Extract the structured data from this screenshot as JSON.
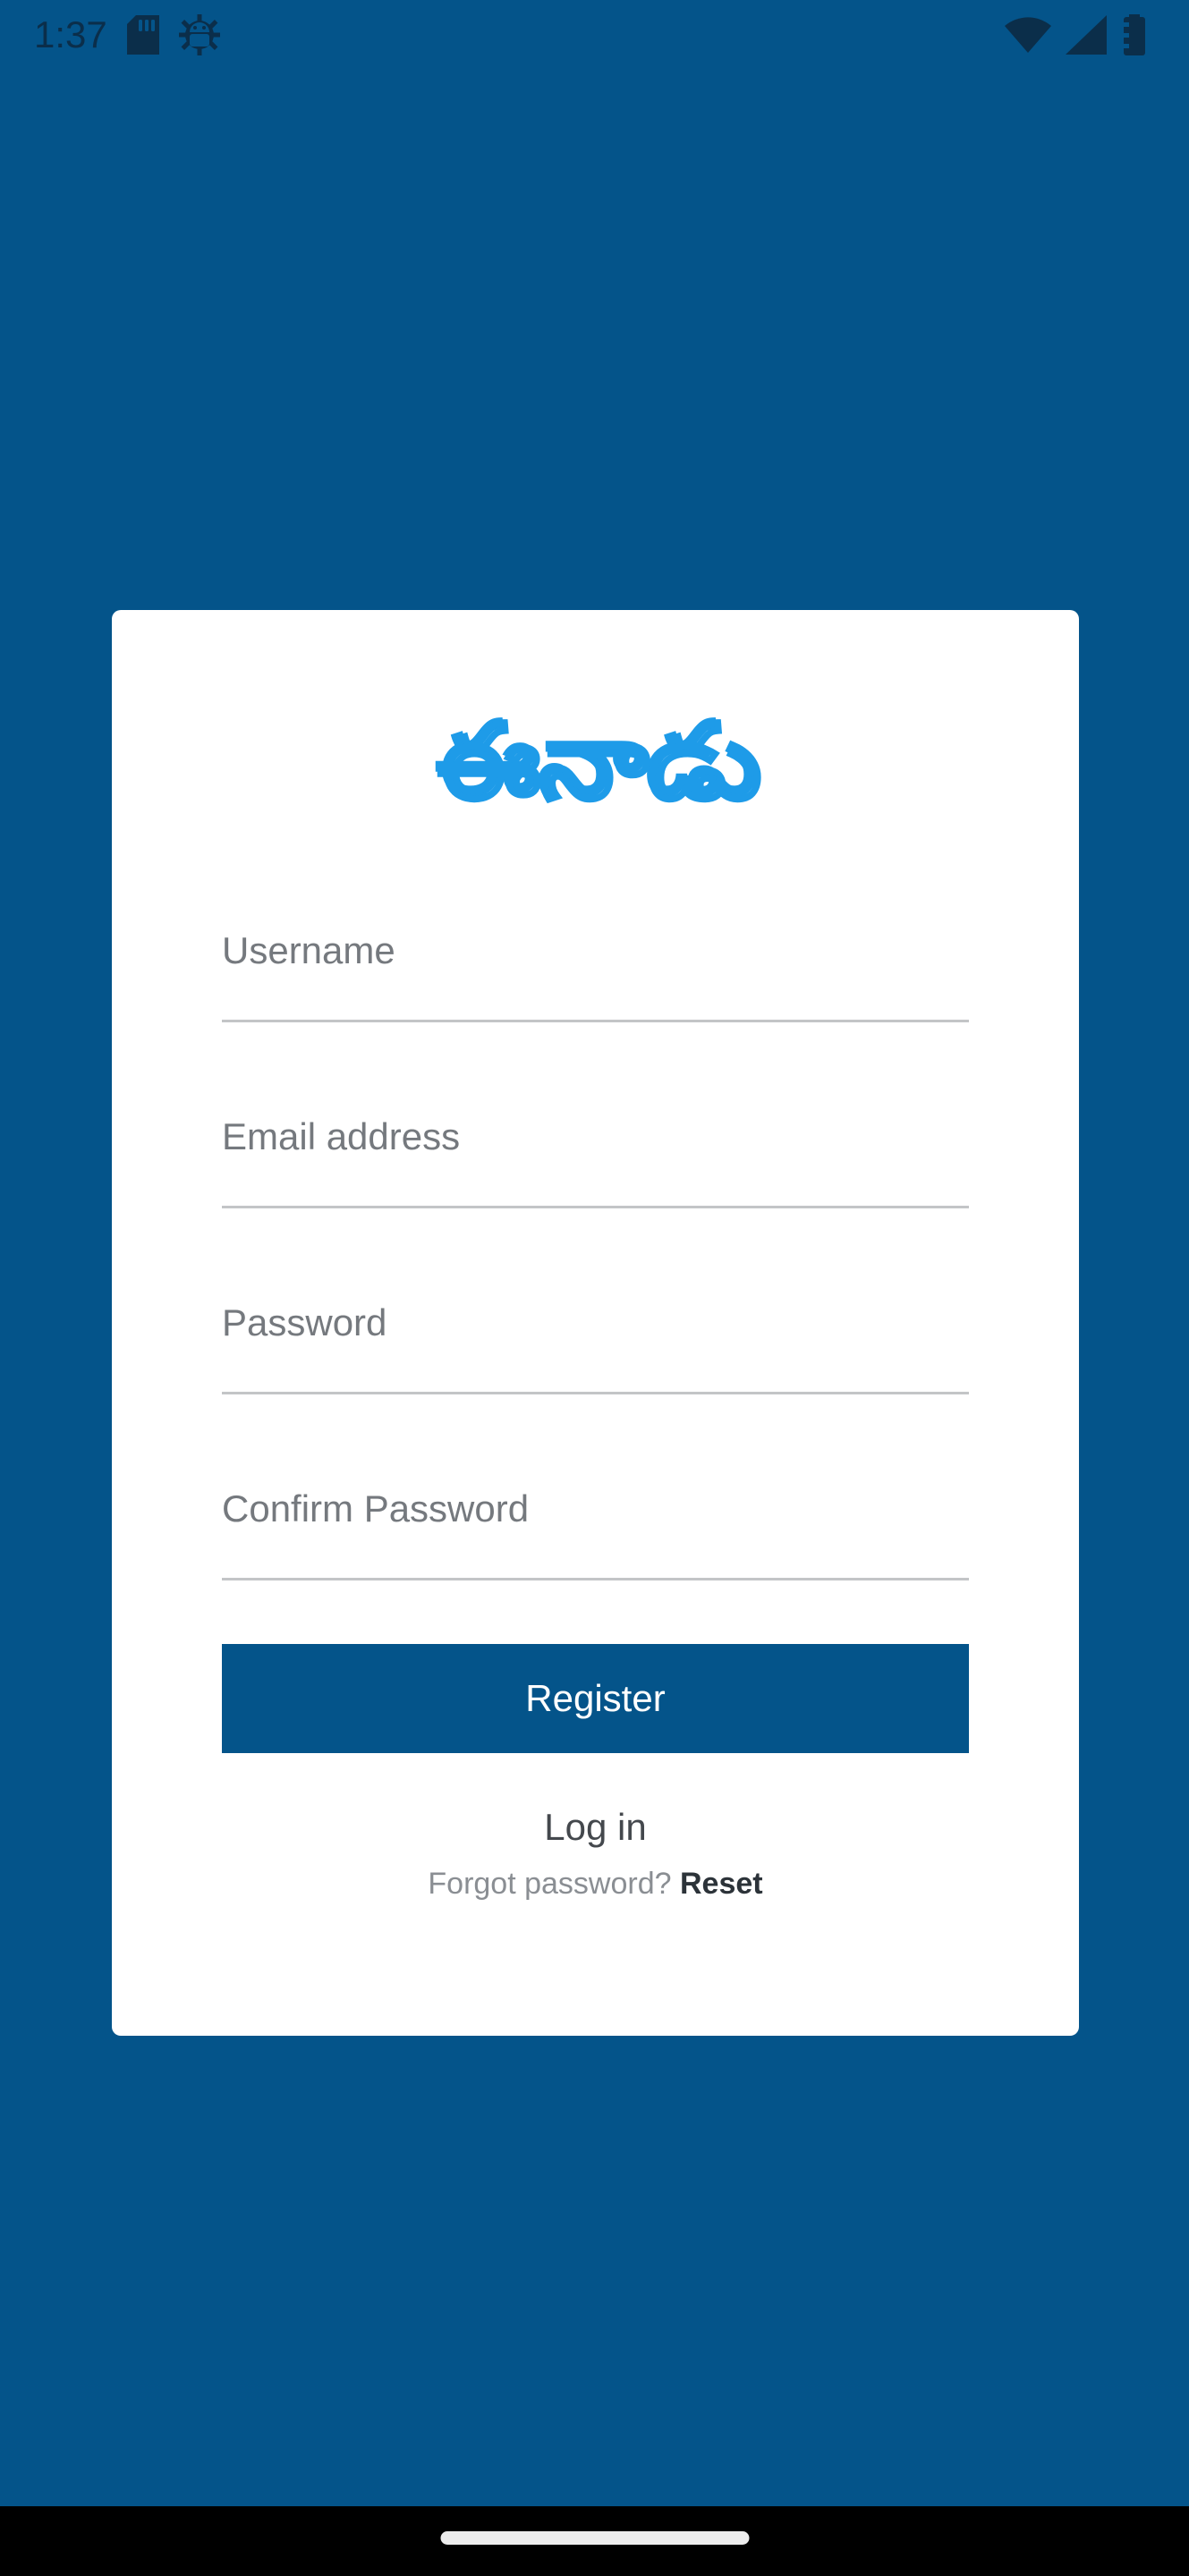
{
  "status_bar": {
    "time": "1:37",
    "left_icons": [
      "sd-card-icon",
      "android-debug-icon"
    ],
    "right_icons": [
      "wifi-icon",
      "cellular-signal-icon",
      "battery-icon"
    ]
  },
  "brand": {
    "logo_name": "eenadu-logo",
    "logo_text": "ఈనాడు",
    "logo_color": "#1E9BE8"
  },
  "form": {
    "fields": [
      {
        "name": "username",
        "placeholder": "Username",
        "value": "",
        "type": "text"
      },
      {
        "name": "email",
        "placeholder": "Email address",
        "value": "",
        "type": "email"
      },
      {
        "name": "password",
        "placeholder": "Password",
        "value": "",
        "type": "password"
      },
      {
        "name": "confirm_password",
        "placeholder": "Confirm Password",
        "value": "",
        "type": "password"
      }
    ],
    "submit_label": "Register"
  },
  "links": {
    "login_label": "Log in",
    "forgot_prefix": "Forgot password? ",
    "reset_label": "Reset"
  },
  "colors": {
    "background": "#04548A",
    "card": "#FFFFFF",
    "primary_button": "#04548A",
    "placeholder_text": "#75797E",
    "underline": "#C3C5C7",
    "nav_bar": "#000000"
  },
  "nav_bar": {
    "handle_name": "gesture-home-handle"
  }
}
